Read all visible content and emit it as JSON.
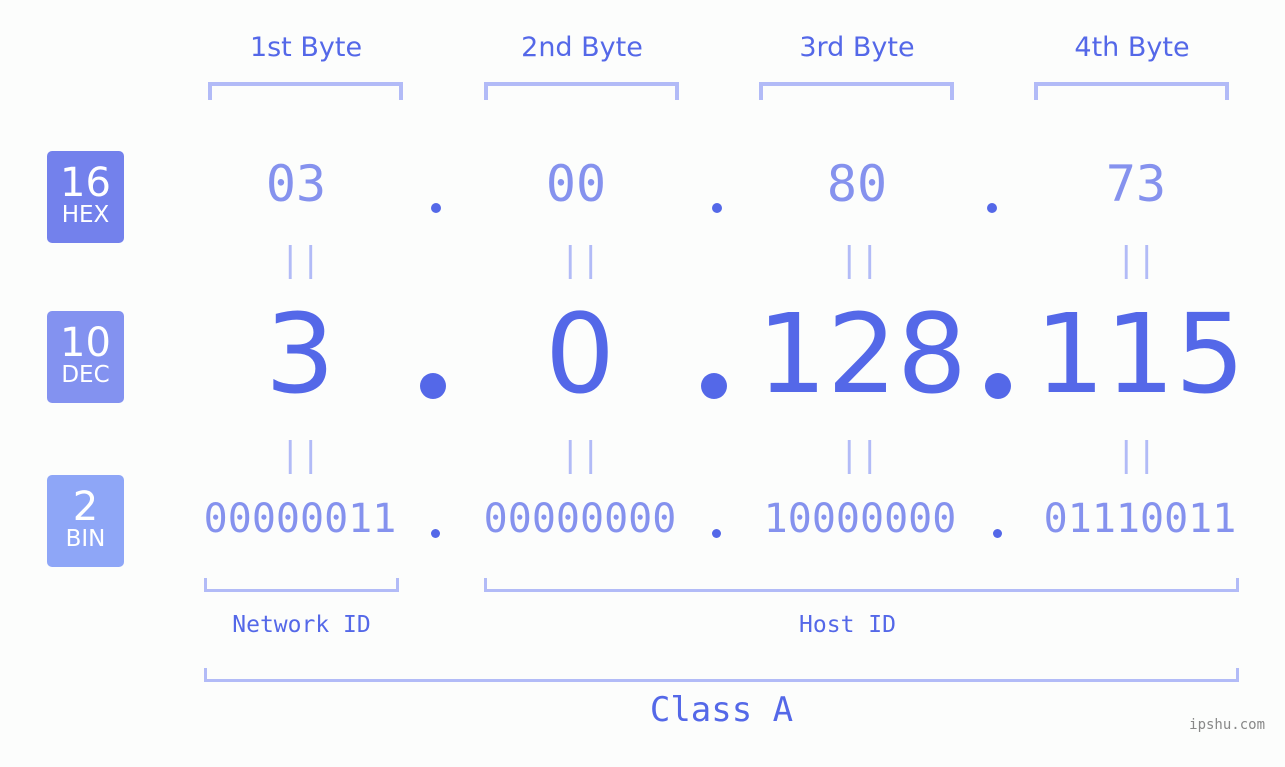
{
  "bytes": [
    {
      "label": "1st Byte",
      "hex": "03",
      "dec": "3",
      "bin": "00000011"
    },
    {
      "label": "2nd Byte",
      "hex": "00",
      "dec": "0",
      "bin": "00000000"
    },
    {
      "label": "3rd Byte",
      "hex": "80",
      "dec": "128",
      "bin": "10000000"
    },
    {
      "label": "4th Byte",
      "hex": "73",
      "dec": "115",
      "bin": "01110011"
    }
  ],
  "badges": {
    "hex": {
      "num": "16",
      "label": "HEX",
      "color": "#7381ec"
    },
    "dec": {
      "num": "10",
      "label": "DEC",
      "color": "#8392f0"
    },
    "bin": {
      "num": "2",
      "label": "BIN",
      "color": "#8ea6f7"
    }
  },
  "equals_glyph": "||",
  "segments": {
    "network": "Network ID",
    "host": "Host ID"
  },
  "class_label": "Class A",
  "watermark": "ipshu.com",
  "colors": {
    "accent": "#5468e8",
    "light_accent": "#8592ee",
    "bracket": "#b2bbf7"
  }
}
